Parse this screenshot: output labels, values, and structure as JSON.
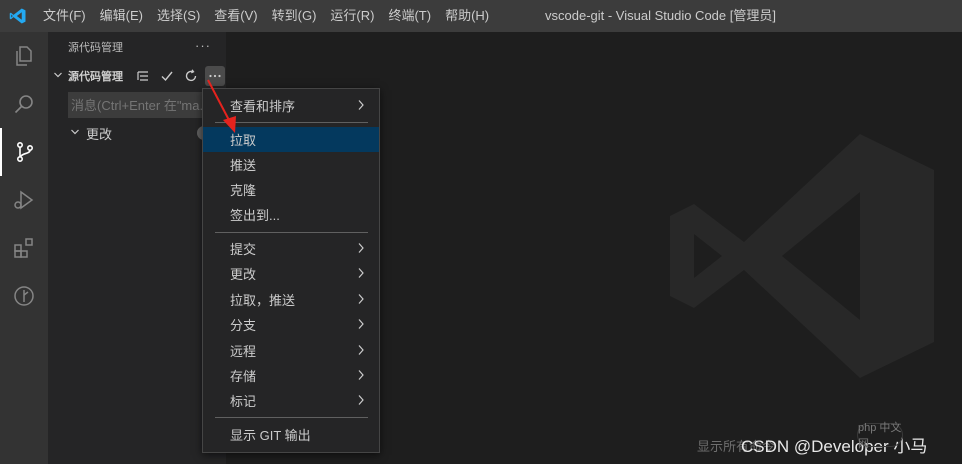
{
  "titlebar": {
    "menu": [
      {
        "label": "文件(F)"
      },
      {
        "label": "编辑(E)"
      },
      {
        "label": "选择(S)"
      },
      {
        "label": "查看(V)"
      },
      {
        "label": "转到(G)"
      },
      {
        "label": "运行(R)"
      },
      {
        "label": "终端(T)"
      },
      {
        "label": "帮助(H)"
      }
    ],
    "window_title": "vscode-git - Visual Studio Code [管理员]"
  },
  "activitybar": {
    "icons": [
      "explorer-icon",
      "search-icon",
      "source-control-icon",
      "run-debug-icon",
      "extensions-icon",
      "git-graph-icon"
    ],
    "active": "source-control-icon"
  },
  "sidebar": {
    "header": "源代码管理",
    "header_more": "···",
    "section_title": "源代码管理",
    "message_placeholder": "消息(Ctrl+Enter 在\"ma...",
    "changes_label": "更改"
  },
  "context_menu": {
    "highlighted": "拉取",
    "items": [
      {
        "label": "查看和排序",
        "submenu": true
      },
      {
        "label": "拉取",
        "submenu": false
      },
      {
        "label": "推送",
        "submenu": false
      },
      {
        "label": "克隆",
        "submenu": false
      },
      {
        "label": "签出到...",
        "submenu": false
      },
      {
        "label": "提交",
        "submenu": true
      },
      {
        "label": "更改",
        "submenu": true
      },
      {
        "label": "拉取，推送",
        "submenu": true
      },
      {
        "label": "分支",
        "submenu": true
      },
      {
        "label": "远程",
        "submenu": true
      },
      {
        "label": "存储",
        "submenu": true
      },
      {
        "label": "标记",
        "submenu": true
      },
      {
        "label": "显示 GIT 输出",
        "submenu": false
      }
    ]
  },
  "watermark": {
    "footer_text": "显示所有命令",
    "csdn": "CSDN @Developer 小马",
    "php_badge": "php 中文网"
  },
  "colors": {
    "accent": "#04395e",
    "vscode_blue": "#23a9f2",
    "arrow": "#e5231e"
  }
}
